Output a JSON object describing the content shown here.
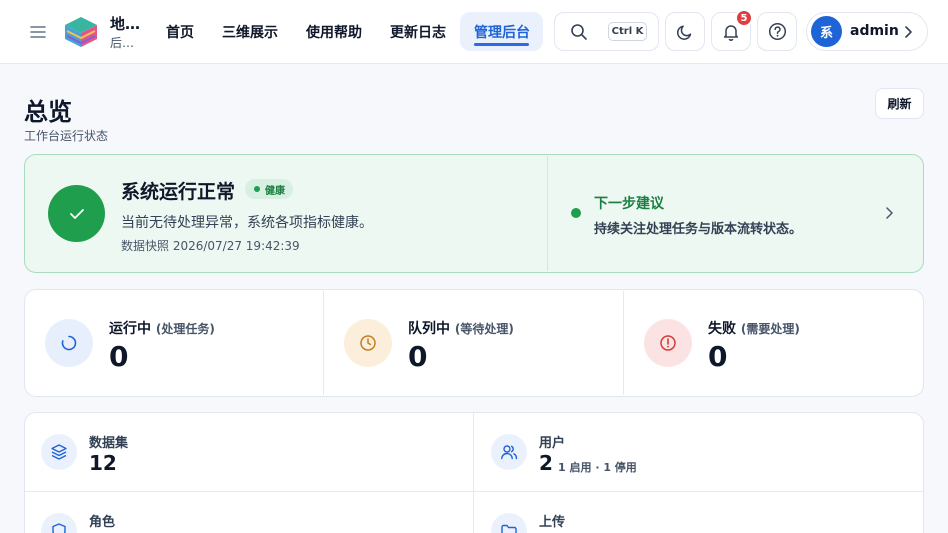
{
  "header": {
    "brand_title": "地…",
    "brand_subtitle": "后…",
    "nav": [
      {
        "label": "首页"
      },
      {
        "label": "三维展示"
      },
      {
        "label": "使用帮助"
      },
      {
        "label": "更新日志"
      },
      {
        "label": "管理后台",
        "active": true
      }
    ],
    "search_shortcut": "Ctrl K",
    "notification_count": "5",
    "avatar_text": "系",
    "username": "admin",
    "icons": [
      "menu-icon",
      "logo-icon",
      "search-icon",
      "moon-icon",
      "bell-icon",
      "help-icon",
      "chevron-right-icon"
    ]
  },
  "page": {
    "title": "总览",
    "subtitle": "工作台运行状态",
    "refresh_label": "刷新"
  },
  "health": {
    "title": "系统运行正常",
    "chip": "健康",
    "description": "当前无待处理异常，系统各项指标健康。",
    "snapshot": "数据快照 2026/07/27 19:42:39",
    "next_title": "下一步建议",
    "next_description": "持续关注处理任务与版本流转状态。"
  },
  "status_cards": [
    {
      "label": "运行中",
      "note": "(处理任务)",
      "value": "0",
      "icon": "spinner-icon",
      "color": "#1f64d6"
    },
    {
      "label": "队列中",
      "note": "(等待处理)",
      "value": "0",
      "icon": "clock-icon",
      "color": "#d08a2a"
    },
    {
      "label": "失败",
      "note": "(需要处理)",
      "value": "0",
      "icon": "alert-icon",
      "color": "#d33b3b"
    }
  ],
  "resources": [
    {
      "label": "数据集",
      "value": "12",
      "note": "",
      "icon": "layers-icon"
    },
    {
      "label": "用户",
      "value": "2",
      "note": "1 启用 · 1 停用",
      "icon": "users-icon"
    },
    {
      "label": "角色",
      "value": "",
      "note": "",
      "icon": "shield-icon"
    },
    {
      "label": "上传",
      "value": "",
      "note": "",
      "icon": "folder-upload-icon"
    }
  ],
  "colors": {
    "accent": "#1f64d6",
    "success": "#1f9e4d",
    "warning": "#d08a2a",
    "danger": "#d33b3b"
  }
}
